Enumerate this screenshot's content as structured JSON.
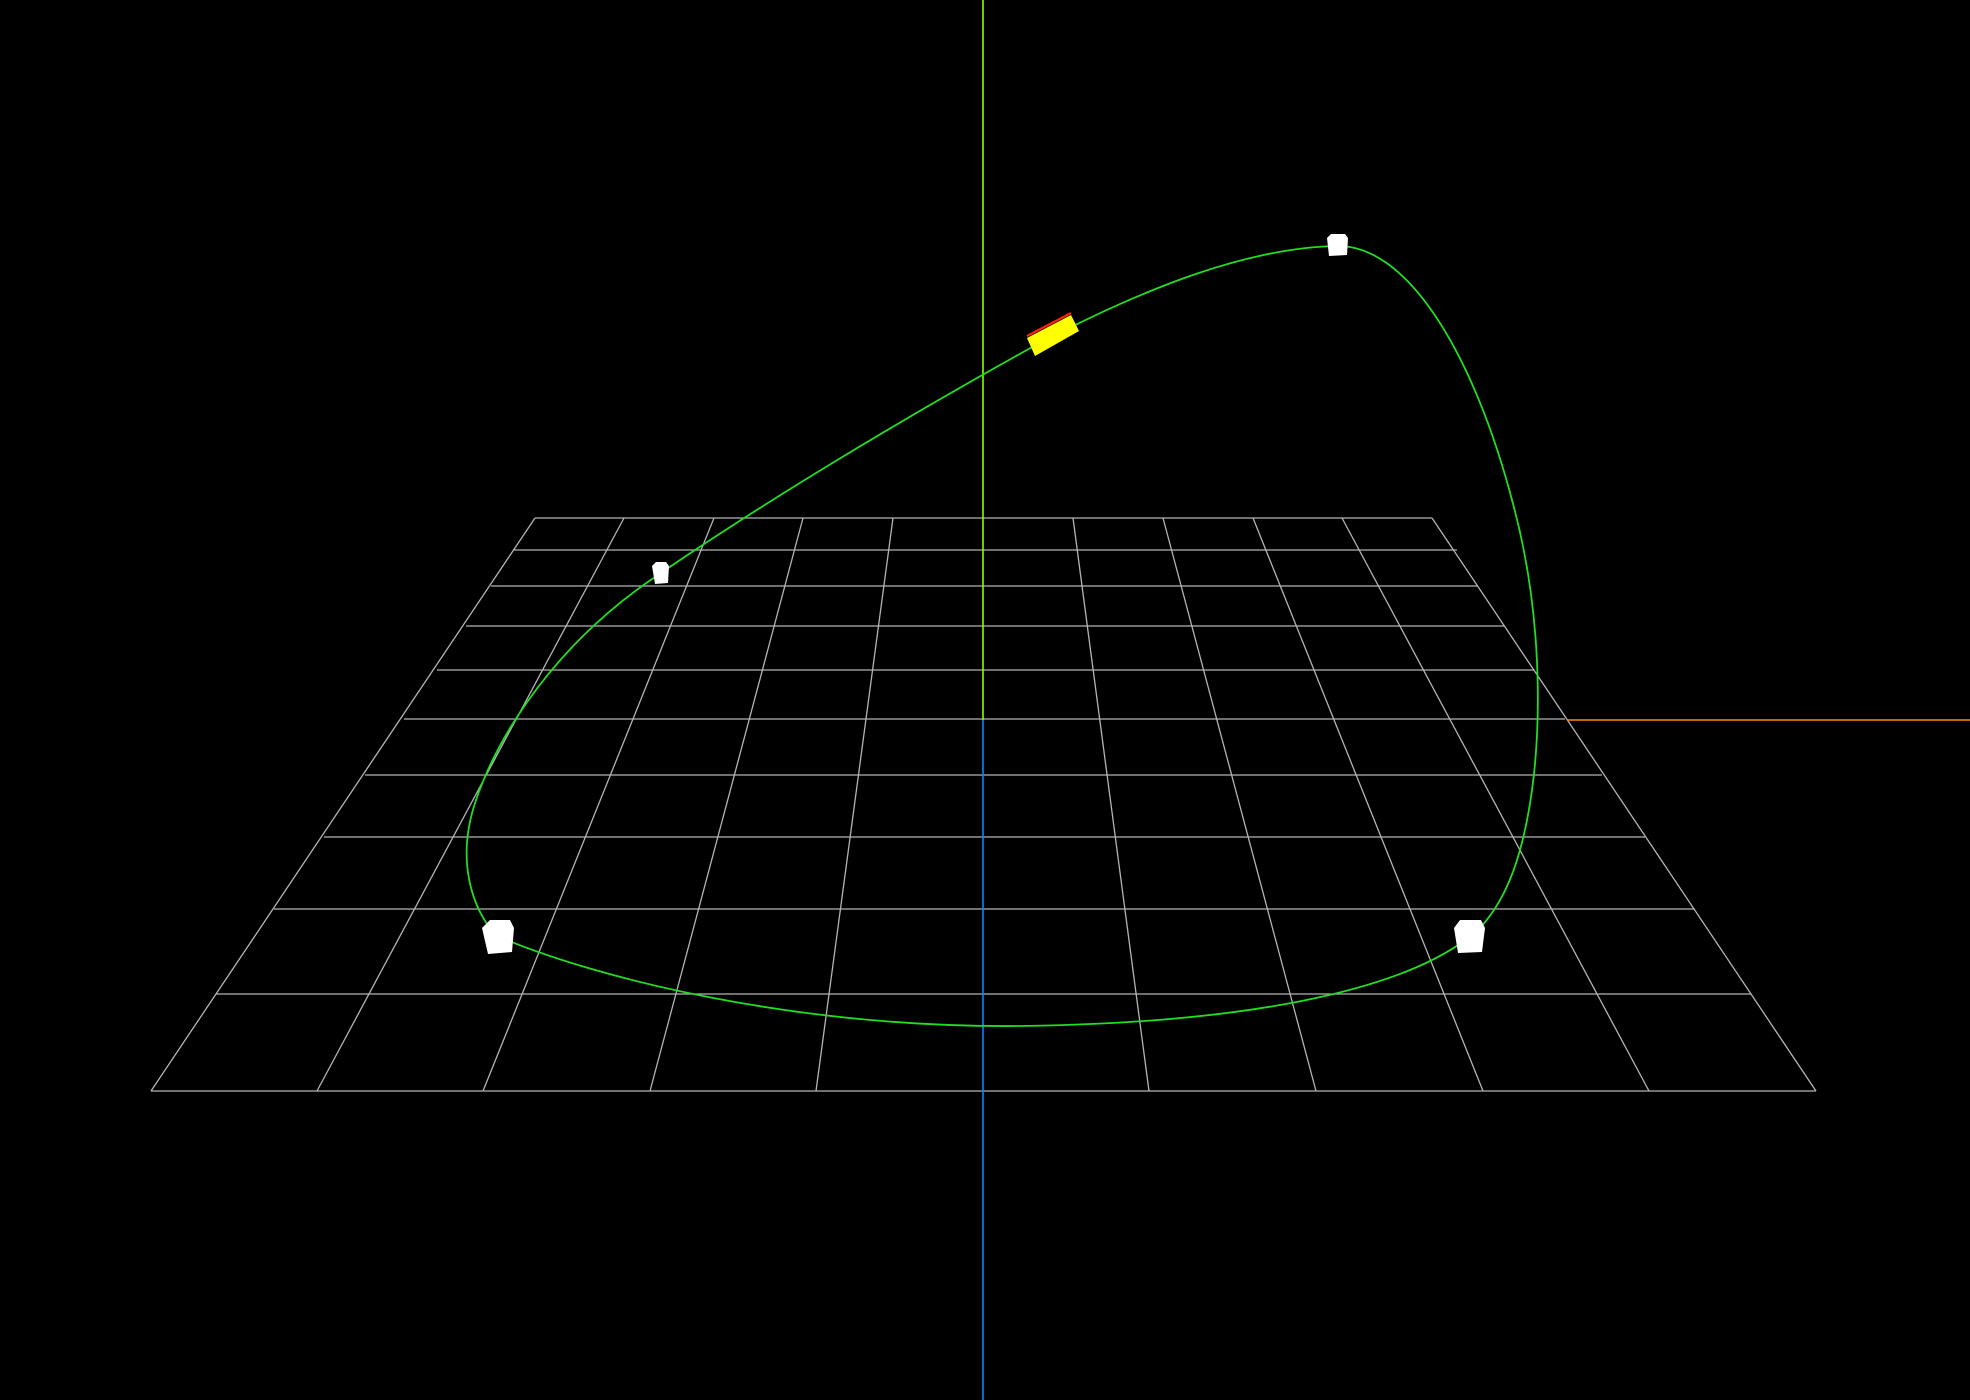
{
  "scene": {
    "background_color": "#000000",
    "grid": {
      "divisions": 10,
      "line_color": "#b4b4b4"
    },
    "axes": {
      "x_axis_color": "#ff8800",
      "y_axis_color": "#88ff00",
      "z_axis_color": "#0088ff"
    },
    "curve": {
      "type": "closed-spline",
      "color": "#22dd22",
      "control_point_count": 4,
      "control_point_color": "#ffffff"
    },
    "follower": {
      "fill_color": "#ffff00",
      "edge_color": "#ff2200"
    }
  }
}
